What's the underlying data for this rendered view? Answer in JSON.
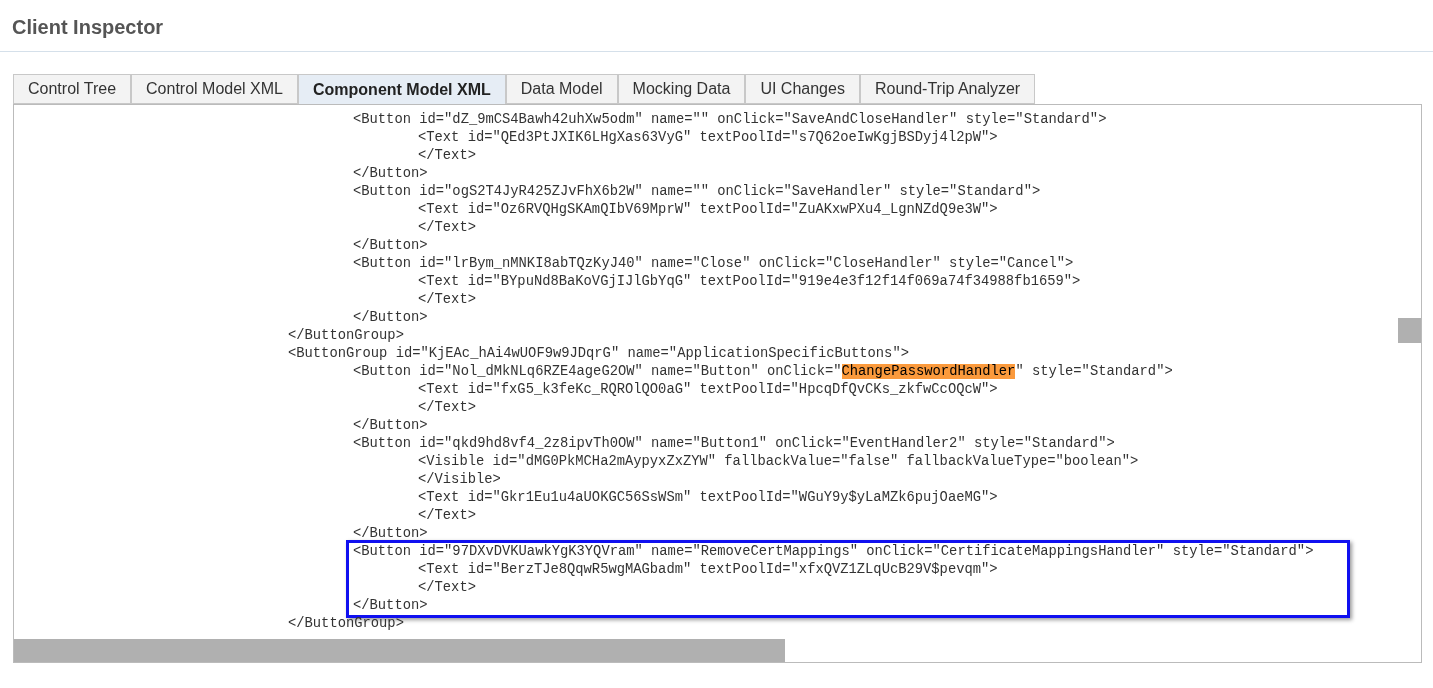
{
  "title": "Client Inspector",
  "tabs": [
    {
      "label": "Control Tree",
      "selected": false
    },
    {
      "label": "Control Model XML",
      "selected": false
    },
    {
      "label": "Component Model XML",
      "selected": true
    },
    {
      "label": "Data Model",
      "selected": false
    },
    {
      "label": "Mocking Data",
      "selected": false
    },
    {
      "label": "UI Changes",
      "selected": false
    },
    {
      "label": "Round-Trip Analyzer",
      "selected": false
    }
  ],
  "xml": [
    {
      "children": [
        {
          "open": "<Button id=\"dZ_9mCS4Bawh42uhXw5odm\" name=\"\" onClick=\"SaveAndCloseHandler\" style=\"Standard\">",
          "framed": false,
          "children": [
            {
              "open": "<Text id=\"QEd3PtJXIK6LHgXas63VyG\" textPoolId=\"s7Q62oeIwKgjBSDyj4l2pW\">",
              "close": "</Text>"
            }
          ],
          "close": "</Button>"
        },
        {
          "open": "<Button id=\"ogS2T4JyR425ZJvFhX6b2W\" name=\"\" onClick=\"SaveHandler\" style=\"Standard\">",
          "framed": false,
          "children": [
            {
              "open": "<Text id=\"Oz6RVQHgSKAmQIbV69MprW\" textPoolId=\"ZuAKxwPXu4_LgnNZdQ9e3W\">",
              "close": "</Text>"
            }
          ],
          "close": "</Button>"
        },
        {
          "open": "<Button id=\"lrBym_nMNKI8abTQzKyJ40\" name=\"Close\" onClick=\"CloseHandler\" style=\"Cancel\">",
          "framed": false,
          "children": [
            {
              "open": "<Text id=\"BYpuNd8BaKoVGjIJlGbYqG\" textPoolId=\"919e4e3f12f14f069a74f34988fb1659\">",
              "close": "</Text>"
            }
          ],
          "close": "</Button>"
        }
      ],
      "close": "</ButtonGroup>"
    },
    {
      "open": "<ButtonGroup id=\"KjEAc_hAi4wUOF9w9JDqrG\" name=\"ApplicationSpecificButtons\">",
      "children": [
        {
          "open": [
            {
              "text": "<Button id=\"Nol_dMkNLq6RZE4ageG2OW\" name=\"Button\" onClick=\"",
              "highlighted": false
            },
            {
              "text": "ChangePasswordHandler",
              "highlighted": true
            },
            {
              "text": "\" style=\"Standard\">",
              "highlighted": false
            }
          ],
          "framed": false,
          "children": [
            {
              "open": "<Text id=\"fxG5_k3feKc_RQROlQO0aG\" textPoolId=\"HpcqDfQvCKs_zkfwCcOQcW\">",
              "close": "</Text>"
            }
          ],
          "close": "</Button>"
        },
        {
          "open": "<Button id=\"qkd9hd8vf4_2z8ipvTh0OW\" name=\"Button1\" onClick=\"EventHandler2\" style=\"Standard\">",
          "framed": false,
          "children": [
            {
              "open": "<Visible id=\"dMG0PkMCHa2mAypyxZxZYW\" fallbackValue=\"false\" fallbackValueType=\"boolean\">",
              "close": "</Visible>"
            },
            {
              "open": "<Text id=\"Gkr1Eu1u4aUOKGC56SsWSm\" textPoolId=\"WGuY9y$yLaMZk6pujOaeMG\">",
              "close": "</Text>"
            }
          ],
          "close": "</Button>"
        },
        {
          "open": "<Button id=\"97DXvDVKUawkYgK3YQVram\" name=\"RemoveCertMappings\" onClick=\"CertificateMappingsHandler\" style=\"Standard\">",
          "framed": true,
          "children": [
            {
              "open": "<Text id=\"BerzTJe8QqwR5wgMAGbadm\" textPoolId=\"xfxQVZ1ZLqUcB29V$pevqm\">",
              "close": "</Text>"
            }
          ],
          "close": "</Button>"
        }
      ],
      "close": "</ButtonGroup>"
    }
  ]
}
